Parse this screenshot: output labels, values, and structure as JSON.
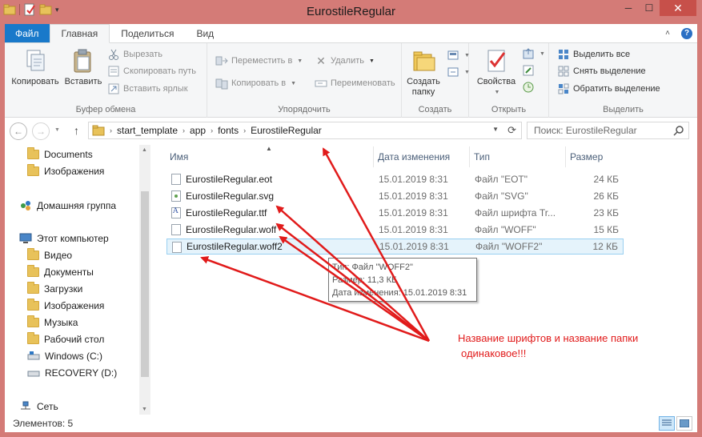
{
  "window": {
    "title": "EurostileRegular"
  },
  "ribbon_tabs": [
    "Файл",
    "Главная",
    "Поделиться",
    "Вид"
  ],
  "ribbon": {
    "clipboard": {
      "copy": "Копировать",
      "paste": "Вставить",
      "cut": "Вырезать",
      "copy_path": "Скопировать путь",
      "paste_shortcut": "Вставить ярлык",
      "label": "Буфер обмена"
    },
    "organize": {
      "move_to": "Переместить в",
      "copy_to": "Копировать в",
      "delete": "Удалить",
      "rename": "Переименовать",
      "label": "Упорядочить"
    },
    "new": {
      "new_folder_line1": "Создать",
      "new_folder_line2": "папку",
      "label": "Создать"
    },
    "open": {
      "properties": "Свойства",
      "label": "Открыть"
    },
    "select": {
      "select_all": "Выделить все",
      "select_none": "Снять выделение",
      "invert": "Обратить выделение",
      "label": "Выделить"
    }
  },
  "address": {
    "path": [
      "start_template",
      "app",
      "fonts",
      "EurostileRegular"
    ]
  },
  "search": {
    "placeholder": "Поиск: EurostileRegular"
  },
  "sidebar": {
    "documents": "Documents",
    "images_en": "Изображения",
    "homegroup": "Домашняя группа",
    "this_pc": "Этот компьютер",
    "video": "Видео",
    "docs": "Документы",
    "downloads": "Загрузки",
    "images": "Изображения",
    "music": "Музыка",
    "desktop": "Рабочий стол",
    "windows_c": "Windows (C:)",
    "recovery_d": "RECOVERY (D:)",
    "network": "Сеть"
  },
  "columns": {
    "name": "Имя",
    "date": "Дата изменения",
    "type": "Тип",
    "size": "Размер"
  },
  "files": [
    {
      "name": "EurostileRegular.eot",
      "date": "15.01.2019 8:31",
      "type": "Файл \"EOT\"",
      "size": "24 КБ"
    },
    {
      "name": "EurostileRegular.svg",
      "date": "15.01.2019 8:31",
      "type": "Файл \"SVG\"",
      "size": "26 КБ"
    },
    {
      "name": "EurostileRegular.ttf",
      "date": "15.01.2019 8:31",
      "type": "Файл шрифта Tr...",
      "size": "23 КБ"
    },
    {
      "name": "EurostileRegular.woff",
      "date": "15.01.2019 8:31",
      "type": "Файл \"WOFF\"",
      "size": "15 КБ"
    },
    {
      "name": "EurostileRegular.woff2",
      "date": "15.01.2019 8:31",
      "type": "Файл \"WOFF2\"",
      "size": "12 КБ"
    }
  ],
  "tooltip": {
    "type": "Тип: Файл \"WOFF2\"",
    "size": "Размер: 11,3 КБ",
    "date": "Дата изменения: 15.01.2019 8:31"
  },
  "status": {
    "count": "Элементов: 5"
  },
  "annotation": {
    "line1": "Название шрифтов и название папки",
    "line2": "одинаковое!!!",
    "color": "#e11b1b"
  }
}
